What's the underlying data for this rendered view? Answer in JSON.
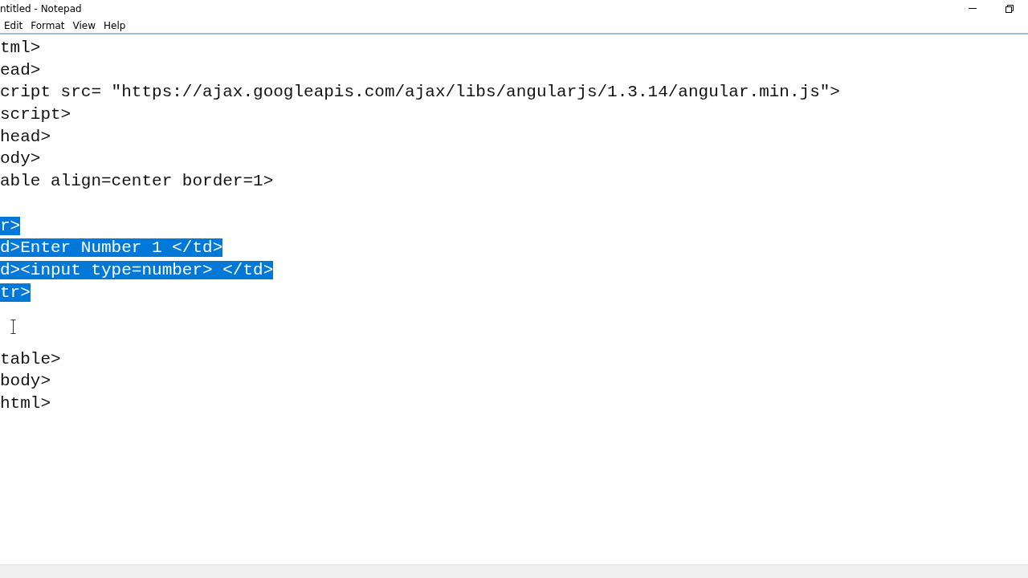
{
  "window": {
    "title": "ntitled - Notepad"
  },
  "menu": [
    "Edit",
    "Format",
    "View",
    "Help"
  ],
  "editor": {
    "lines": [
      {
        "kind": "text",
        "text": "tml>",
        "selected": false
      },
      {
        "kind": "text",
        "text": "ead>",
        "selected": false
      },
      {
        "kind": "text",
        "text": "cript src= \"https://ajax.googleapis.com/ajax/libs/angularjs/1.3.14/angular.min.js\">",
        "selected": false
      },
      {
        "kind": "text",
        "text": "script>",
        "selected": false
      },
      {
        "kind": "text",
        "text": "head>",
        "selected": false
      },
      {
        "kind": "text",
        "text": "ody>",
        "selected": false
      },
      {
        "kind": "text",
        "text": "able align=center border=1>",
        "selected": false
      },
      {
        "kind": "blank"
      },
      {
        "kind": "text",
        "text": "r>",
        "selected": true
      },
      {
        "kind": "text",
        "text": "d>Enter Number 1 </td>",
        "selected": true
      },
      {
        "kind": "text",
        "text": "d><input type=number> </td>",
        "selected": true
      },
      {
        "kind": "text",
        "text": "tr>",
        "selected": true
      },
      {
        "kind": "blank"
      },
      {
        "kind": "blank"
      },
      {
        "kind": "text",
        "text": "table>",
        "selected": false
      },
      {
        "kind": "text",
        "text": "body>",
        "selected": false
      },
      {
        "kind": "text",
        "text": "html>",
        "selected": false
      }
    ]
  }
}
